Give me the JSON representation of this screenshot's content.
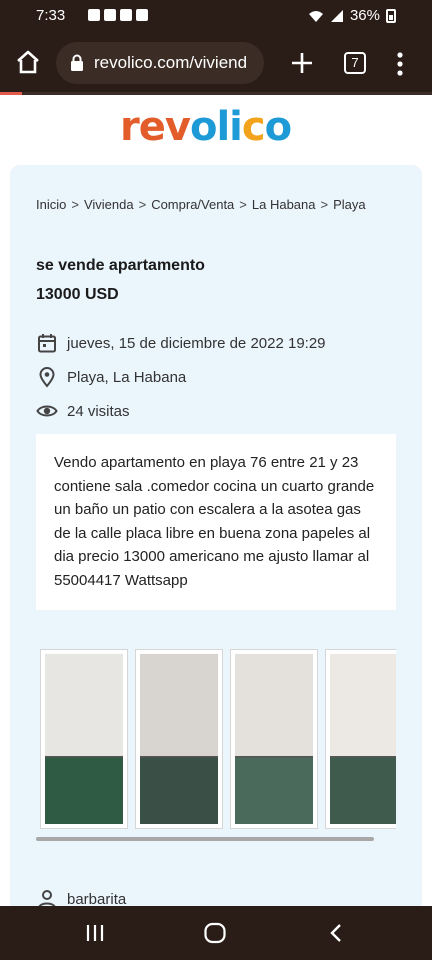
{
  "status_bar": {
    "time": "7:33",
    "battery": "36%"
  },
  "browser": {
    "url": "revolico.com/viviend",
    "tab_count": "7"
  },
  "logo": {
    "letters": [
      "r",
      "e",
      "v",
      "o",
      "l",
      "i",
      "c",
      "o"
    ],
    "colors": [
      "#e35d2b",
      "#e35d2b",
      "#e35d2b",
      "#1e9ad6",
      "#1e9ad6",
      "#1e9ad6",
      "#f2a21b",
      "#1e9ad6"
    ]
  },
  "breadcrumb": [
    "Inicio",
    "Vivienda",
    "Compra/Venta",
    "La Habana",
    "Playa"
  ],
  "listing": {
    "title": "se vende apartamento",
    "price": "13000 USD",
    "date": "jueves, 15 de diciembre de 2022 19:29",
    "location": "Playa, La Habana",
    "visits": "24 visitas",
    "description": "Vendo apartamento en playa 76 entre 21 y 23 contiene sala .comedor cocina un cuarto grande un baño un patio con escalera a la asotea gas de la calle placa libre en buena zona papeles al dia precio 13000 americano me ajusto llamar al 55004417 Wattsapp",
    "user": "barbarita"
  },
  "gallery": {
    "photos": [
      {
        "name": "photo-1",
        "wall": "#e8e6e2",
        "floor": "#2f5a43"
      },
      {
        "name": "photo-2",
        "wall": "#d8d4cf",
        "floor": "#3a5046"
      },
      {
        "name": "photo-3",
        "wall": "#e4e0dc",
        "floor": "#4a6b5c"
      },
      {
        "name": "photo-4",
        "wall": "#ece8e4",
        "floor": "#3f5b4e"
      }
    ]
  }
}
